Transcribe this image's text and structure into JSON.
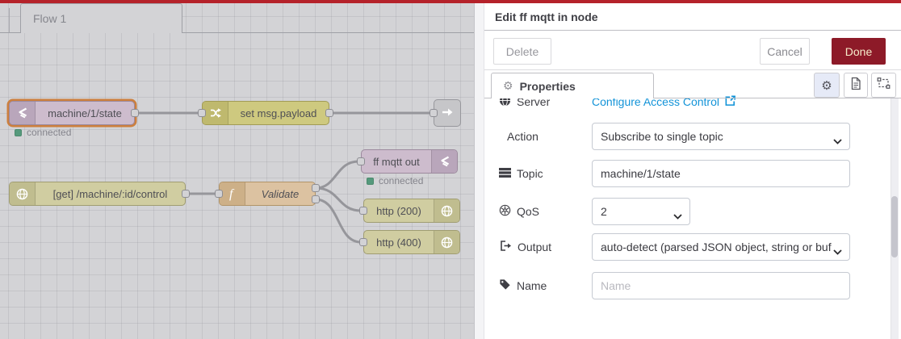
{
  "glyphs": {
    "gear": "⚙"
  },
  "colors": {
    "topbar_red": "#b5222a",
    "done_button_red": "#8d1a28",
    "link_blue": "#1293d8",
    "status_green": "#55997c",
    "selection_orange": "#cc7f3e"
  },
  "canvas": {
    "flow_tab": "Flow 1",
    "nodes": {
      "mqtt_in": {
        "label": "machine/1/state",
        "status": "connected"
      },
      "change": {
        "label": "set msg.payload"
      },
      "http_in": {
        "label": "[get] /machine/:id/control"
      },
      "function": {
        "label": "Validate"
      },
      "mqtt_out": {
        "label": "ff mqtt out",
        "status": "connected"
      },
      "http_200": {
        "label": "http (200)"
      },
      "http_400": {
        "label": "http (400)"
      }
    }
  },
  "panel": {
    "title": "Edit ff mqtt in node",
    "buttons": {
      "delete": "Delete",
      "cancel": "Cancel",
      "done": "Done"
    },
    "tab": {
      "label": "Properties"
    },
    "fields": {
      "server": {
        "label": "Server",
        "link": "Configure Access Control"
      },
      "action": {
        "label": "Action",
        "value": "Subscribe to single topic"
      },
      "topic": {
        "label": "Topic",
        "value": "machine/1/state"
      },
      "qos": {
        "label": "QoS",
        "value": "2"
      },
      "output": {
        "label": "Output",
        "value": "auto-detect (parsed JSON object, string or buf"
      },
      "name": {
        "label": "Name",
        "placeholder": "Name"
      }
    }
  }
}
